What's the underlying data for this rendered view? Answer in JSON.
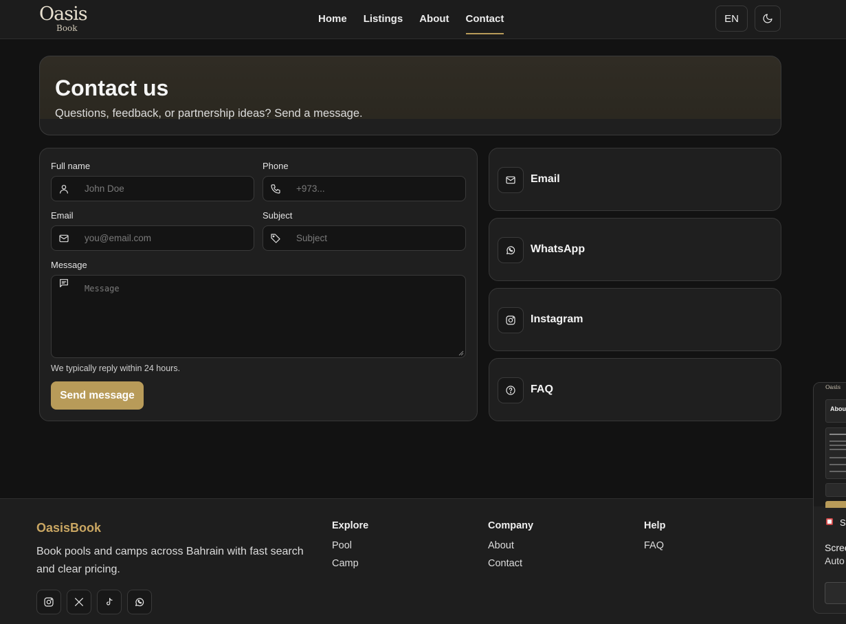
{
  "nav": {
    "logo_main": "Oasis",
    "logo_sub": "Book",
    "links": [
      "Home",
      "Listings",
      "About",
      "Contact"
    ],
    "active": "Contact",
    "lang": "EN"
  },
  "hero": {
    "title": "Contact us",
    "subtitle": "Questions, feedback, or partnership ideas? Send a message."
  },
  "form": {
    "full_name_label": "Full name",
    "full_name_placeholder": "John Doe",
    "phone_label": "Phone",
    "phone_placeholder": "+973...",
    "email_label": "Email",
    "email_placeholder": "you@email.com",
    "subject_label": "Subject",
    "subject_placeholder": "Subject",
    "message_label": "Message",
    "message_placeholder": "Message",
    "hint": "We typically reply within 24 hours.",
    "submit": "Send message"
  },
  "channels": [
    {
      "label": "Email",
      "icon": "mail-icon"
    },
    {
      "label": "WhatsApp",
      "icon": "whatsapp-icon"
    },
    {
      "label": "Instagram",
      "icon": "instagram-icon"
    },
    {
      "label": "FAQ",
      "icon": "help-circle-icon"
    }
  ],
  "footer": {
    "brand": "OasisBook",
    "tagline": "Book pools and camps across Bahrain with fast search and clear pricing.",
    "socials": [
      "instagram-icon",
      "x-icon",
      "tiktok-icon",
      "whatsapp-icon"
    ],
    "explore": {
      "title": "Explore",
      "links": [
        "Pool",
        "Camp"
      ]
    },
    "company": {
      "title": "Company",
      "links": [
        "About",
        "Contact"
      ]
    },
    "help": {
      "title": "Help",
      "links": [
        "FAQ"
      ]
    }
  },
  "preview_popup": {
    "logo": "Oasis",
    "card_title": "Abou",
    "app_name": "S",
    "line1": "Scree",
    "line2": "Auto"
  },
  "colors": {
    "accent": "#b89b59",
    "brand": "#c9a662",
    "background": "#121212",
    "card": "#1f1f1f"
  }
}
